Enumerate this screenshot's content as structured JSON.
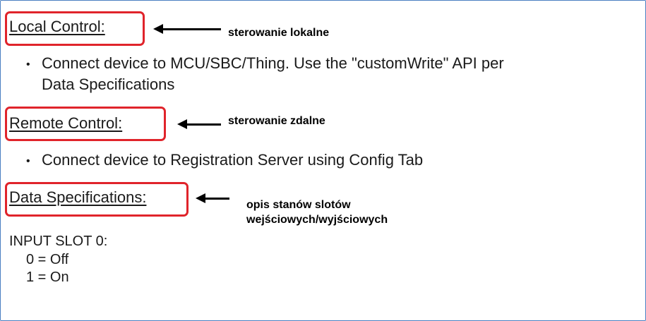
{
  "sections": {
    "local": {
      "heading": "Local Control:",
      "annotation": "sterowanie lokalne",
      "bullet_line1": "Connect device to MCU/SBC/Thing. Use the \"customWrite\" API per",
      "bullet_line2": "Data Specifications"
    },
    "remote": {
      "heading": "Remote Control:",
      "annotation": "sterowanie zdalne",
      "bullet": "Connect device to Registration Server using Config Tab"
    },
    "data_spec": {
      "heading": "Data Specifications:",
      "annotation_line1": "opis stanów slotów",
      "annotation_line2": "wejściowych/wyjściowych"
    }
  },
  "input_slot": {
    "title": "INPUT SLOT 0:",
    "values": [
      "0 = Off",
      "1 = On"
    ]
  },
  "bullet_glyph": "•",
  "colors": {
    "highlight_box": "#e0242b",
    "frame_border": "#4a7fc1",
    "arrow": "#000000"
  }
}
